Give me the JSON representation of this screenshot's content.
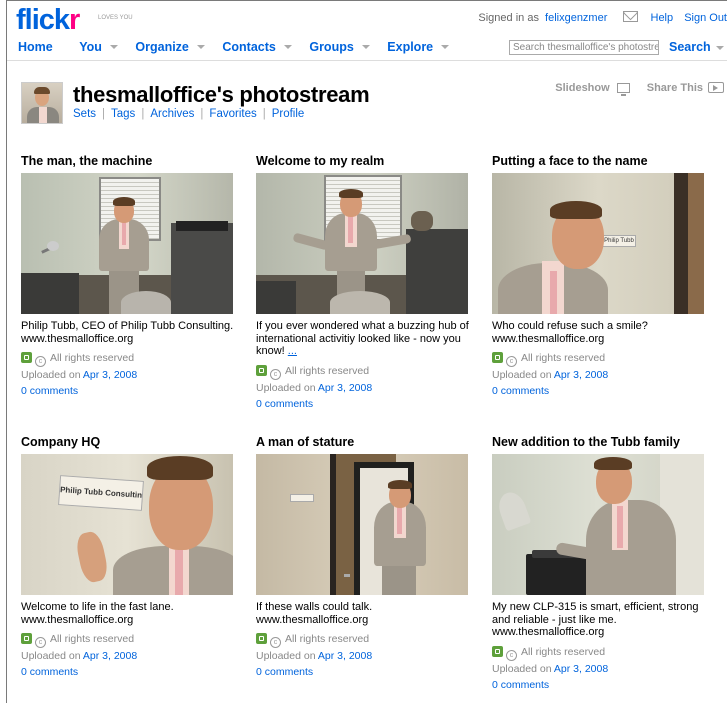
{
  "header": {
    "logo_part1": "flick",
    "logo_part2": "r",
    "logo_tagline": "LOVES YOU",
    "signed_in_prefix": "Signed in as",
    "username": "felixgenzmer",
    "help": "Help",
    "sign_out": "Sign Out",
    "search_placeholder": "Search thesmalloffice's photostream",
    "search_button": "Search"
  },
  "nav": {
    "home": "Home",
    "you": "You",
    "organize": "Organize",
    "contacts": "Contacts",
    "groups": "Groups",
    "explore": "Explore"
  },
  "profile": {
    "title": "thesmalloffice's photostream",
    "links": [
      "Sets",
      "Tags",
      "Archives",
      "Favorites",
      "Profile"
    ],
    "slideshow": "Slideshow",
    "share_this": "Share This"
  },
  "photos": [
    {
      "title": "The man, the machine",
      "desc": "Philip Tubb, CEO of Philip Tubb Consulting. www.thesmalloffice.org",
      "more": "",
      "rights": "All rights reserved",
      "uploaded_prefix": "Uploaded on",
      "date": "Apr 3, 2008",
      "comments": "0 comments"
    },
    {
      "title": "Welcome to my realm",
      "desc": "If you ever wondered what a buzzing hub of international activitiy looked like - now you know! ",
      "more": "...",
      "rights": "All rights reserved",
      "uploaded_prefix": "Uploaded on",
      "date": "Apr 3, 2008",
      "comments": "0 comments"
    },
    {
      "title": "Putting a face to the name",
      "desc": "Who could refuse such a smile? www.thesmalloffice.org",
      "more": "",
      "rights": "All rights reserved",
      "uploaded_prefix": "Uploaded on",
      "date": "Apr 3, 2008",
      "comments": "0 comments"
    },
    {
      "title": "Company HQ",
      "desc": "Welcome to life in the fast lane. www.thesmalloffice.org",
      "more": "",
      "rights": "All rights reserved",
      "uploaded_prefix": "Uploaded on",
      "date": "Apr 3, 2008",
      "comments": "0 comments"
    },
    {
      "title": "A man of stature",
      "desc": "If these walls could talk. www.thesmalloffice.org",
      "more": "",
      "rights": "All rights reserved",
      "uploaded_prefix": "Uploaded on",
      "date": "Apr 3, 2008",
      "comments": "0 comments"
    },
    {
      "title": "New addition to the Tubb family",
      "desc": "My new CLP-315 is smart, efficient, strong and reliable - just like me. www.thesmalloffice.org",
      "more": "",
      "rights": "All rights reserved",
      "uploaded_prefix": "Uploaded on",
      "date": "Apr 3, 2008",
      "comments": "0 comments"
    }
  ],
  "photo_signs": {
    "hq_sign": "Philip Tubb Consulting",
    "small_sign": "Philip Tubb"
  },
  "colors": {
    "link": "#0063dc",
    "flickr_blue": "#0063dc",
    "flickr_pink": "#ff0084"
  }
}
